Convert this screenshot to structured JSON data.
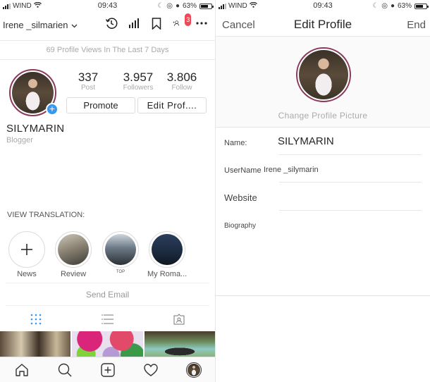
{
  "status_bar": {
    "carrier": "WIND",
    "time_left": "09:43",
    "time_right": "09:43",
    "battery": "63%"
  },
  "profile": {
    "username": "Irene _silmarien",
    "header_icons": [
      "history-icon",
      "insights-icon",
      "bookmark-icon",
      "discover-people-icon",
      "more-icon"
    ],
    "notification_count": "3",
    "profile_views": "69 Profile Views In The Last 7 Days",
    "stats": [
      {
        "value": "337",
        "label": "Post"
      },
      {
        "value": "3.957",
        "label": "Followers"
      },
      {
        "value": "3.806",
        "label": "Follow"
      }
    ],
    "promote_label": "Promote",
    "edit_profile_label": "Edit Prof....",
    "display_name": "SILYMARIN",
    "category": "Blogger",
    "view_translation": "VIEW TRANSLATION:",
    "highlights": [
      {
        "caption": "News",
        "type": "new"
      },
      {
        "caption": "Review",
        "type": "image"
      },
      {
        "caption": "TOP",
        "type": "image"
      },
      {
        "caption": "My Roma...",
        "type": "image"
      }
    ],
    "send_email": "Send Email",
    "tabs": [
      "grid-icon",
      "list-icon",
      "tagged-icon"
    ]
  },
  "bottom_nav": [
    "home-icon",
    "search-icon",
    "add-post-icon",
    "heart-icon",
    "profile-avatar"
  ],
  "edit_profile": {
    "cancel_label": "Cancel",
    "title": "Edit Profile",
    "done_label": "End",
    "change_picture": "Change Profile Picture",
    "fields": [
      {
        "label": "Name:",
        "value": "SILYMARIN"
      },
      {
        "label": "UserName",
        "value": "Irene _silymarin"
      },
      {
        "label": "Website",
        "value": ""
      },
      {
        "label": "Biography",
        "value": ""
      }
    ]
  },
  "colors": {
    "accent_blue": "#3897f0",
    "badge_red": "#ed4956",
    "story_ring": "#8a3b5c",
    "grid_tab_active": "#3897f0"
  }
}
